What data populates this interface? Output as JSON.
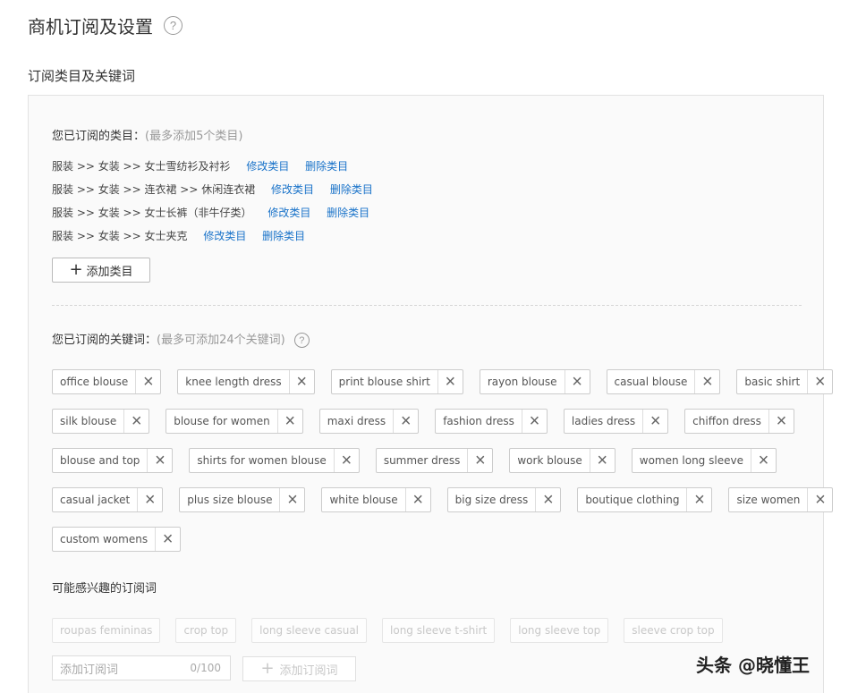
{
  "page_title": "商机订阅及设置",
  "help_glyph": "?",
  "section_title": "订阅类目及关键词",
  "categories": {
    "label": "您已订阅的类目：",
    "hint": "(最多添加5个类目)",
    "rows": [
      {
        "path": "服装 >> 女装 >> 女士雪纺衫及衬衫",
        "modify": "修改类目",
        "delete": "删除类目"
      },
      {
        "path": "服装 >> 女装 >> 连衣裙 >> 休闲连衣裙",
        "modify": "修改类目",
        "delete": "删除类目"
      },
      {
        "path": "服装 >> 女装 >> 女士长裤（非牛仔类）",
        "modify": "修改类目",
        "delete": "删除类目"
      },
      {
        "path": "服装 >> 女装 >> 女士夹克",
        "modify": "修改类目",
        "delete": "删除类目"
      }
    ],
    "add_button": "添加类目"
  },
  "keywords": {
    "label": "您已订阅的关键词：",
    "hint": "(最多可添加24个关键词)",
    "rows": [
      [
        "office blouse",
        "knee length dress",
        "print blouse shirt",
        "rayon blouse",
        "casual blouse",
        "basic shirt"
      ],
      [
        "silk blouse",
        "blouse for women",
        "maxi dress",
        "fashion dress",
        "ladies dress",
        "chiffon dress"
      ],
      [
        "blouse and top",
        "shirts for women blouse",
        "summer dress",
        "work blouse",
        "women long sleeve"
      ],
      [
        "casual jacket",
        "plus size blouse",
        "white blouse",
        "big size dress",
        "boutique clothing",
        "size women"
      ],
      [
        "custom womens"
      ]
    ],
    "remove_glyph": "×"
  },
  "suggestions": {
    "label": "可能感兴趣的订阅词",
    "items": [
      "roupas femininas",
      "crop top",
      "long sleeve casual",
      "long sleeve t-shirt",
      "long sleeve top",
      "sleeve crop top"
    ]
  },
  "add_keyword": {
    "placeholder": "添加订阅词",
    "counter": "0/100",
    "button": "添加订阅词"
  },
  "watermark": "头条 @晓懂王"
}
